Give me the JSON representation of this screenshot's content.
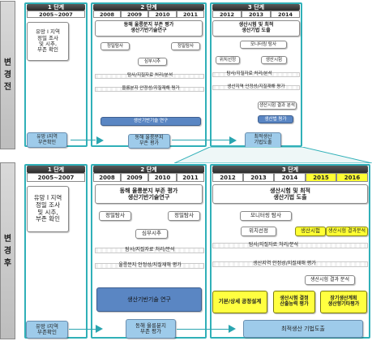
{
  "before": {
    "side_label": "변경전",
    "stages": [
      {
        "label": "1 단계",
        "years": [
          "2005~2007"
        ]
      },
      {
        "label": "2 단계",
        "years": [
          "2008",
          "2009",
          "2010",
          "2011"
        ]
      },
      {
        "label": "3 단계",
        "years": [
          "2012",
          "2013",
          "2014"
        ]
      }
    ],
    "s1_title": "유망 I 지역\n정밀 조사\n및 시추,\n부존 확인",
    "s1_result": "유망 I지역\n부존확인",
    "s2_title": "동해 울릉분지 부존 평가\n생산기반기술연구",
    "s2_tasks": [
      "정밀탐사",
      "정밀탐사",
      "심부시추",
      "탐사/지질자료 처리/분석",
      "울릉분지 안정성/지질재해 평가",
      "생산기반기술 연구"
    ],
    "s2_result": "동해 울릉분지\n부존 평가",
    "s3_title": "생산시험 및 최적\n생산기법 도출",
    "s3_tasks": [
      "모니터링 탐사",
      "위치선정",
      "생산시험",
      "탐사/지질자료 처리/분석",
      "생산지역 안정성/지질재해 평가",
      "생산시험 결과 분석",
      "생산법 평가"
    ],
    "s3_result": "최적생산\n기법도출"
  },
  "after": {
    "side_label": "변경후",
    "stages": [
      {
        "label": "1 단계",
        "years": [
          "2005~2007"
        ]
      },
      {
        "label": "2 단계",
        "years": [
          "2008",
          "2009",
          "2010",
          "2011"
        ]
      },
      {
        "label": "3 단계",
        "years": [
          "2012",
          "2013",
          "2014",
          "2015",
          "2016"
        ]
      }
    ],
    "s1_title": "유망 I 지역\n정밀 조사\n및 시추,\n부존 확인",
    "s1_result": "유망 I지역\n부존확인",
    "s2_title": "동해 울릉분지 부존 평가\n생산기반기술연구",
    "s2_tasks": [
      "정밀탐사",
      "정밀탐사",
      "심부시추",
      "탐사/지질자료 처리/분석",
      "울릉분지 안정성/지질재해 평가",
      "생산기반기술 연구"
    ],
    "s2_result": "동해 울릉분지\n부존 평가",
    "s3_title": "생산시험 및 최적\n생산기법 도출",
    "s3_tasks": [
      "모니터링 탐사",
      "위치선정",
      "생산시험",
      "생산시험 결과분석",
      "탐사/지질자료 처리/분석",
      "생산지역 안정성/지질재해 평가",
      "생산시험 결과 분석",
      "기본/상세 공정설계",
      "생산시험 결정\n산출능력 평가",
      "장기생산계획\n생산향기타평가"
    ],
    "s3_result": "최적생산 기법도출"
  },
  "colors": {
    "panel_border": "#30b0b8",
    "highlight": "#ffff33",
    "blue": "#9ecbea",
    "dark_blue": "#5a86c3"
  }
}
